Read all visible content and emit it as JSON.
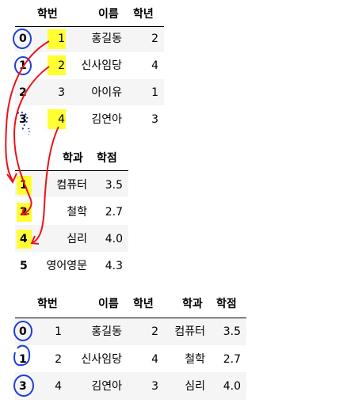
{
  "table1": {
    "columns": [
      "학번",
      "이름",
      "학년"
    ],
    "rows": [
      {
        "index": "0",
        "cells": [
          "1",
          "홍길동",
          "2"
        ]
      },
      {
        "index": "1",
        "cells": [
          "2",
          "신사임당",
          "4"
        ]
      },
      {
        "index": "2",
        "cells": [
          "3",
          "아이유",
          "1"
        ]
      },
      {
        "index": "3",
        "cells": [
          "4",
          "김연아",
          "3"
        ]
      }
    ]
  },
  "table2": {
    "columns": [
      "학과",
      "학점"
    ],
    "rows": [
      {
        "index": "1",
        "cells": [
          "컴퓨터",
          "3.5"
        ]
      },
      {
        "index": "2",
        "cells": [
          "철학",
          "2.7"
        ]
      },
      {
        "index": "4",
        "cells": [
          "심리",
          "4.0"
        ]
      },
      {
        "index": "5",
        "cells": [
          "영어영문",
          "4.3"
        ]
      }
    ]
  },
  "table3": {
    "columns": [
      "학번",
      "이름",
      "학년",
      "학과",
      "학점"
    ],
    "rows": [
      {
        "index": "0",
        "cells": [
          "1",
          "홍길동",
          "2",
          "컴퓨터",
          "3.5"
        ]
      },
      {
        "index": "1",
        "cells": [
          "2",
          "신사임당",
          "4",
          "철학",
          "2.7"
        ]
      },
      {
        "index": "3",
        "cells": [
          "4",
          "김연아",
          "3",
          "심리",
          "4.0"
        ]
      }
    ]
  },
  "colors": {
    "highlight": "#ffff33",
    "annotation_red": "#e8141c",
    "annotation_blue": "#1f3fd6",
    "row_band": "#f5f5f5"
  }
}
